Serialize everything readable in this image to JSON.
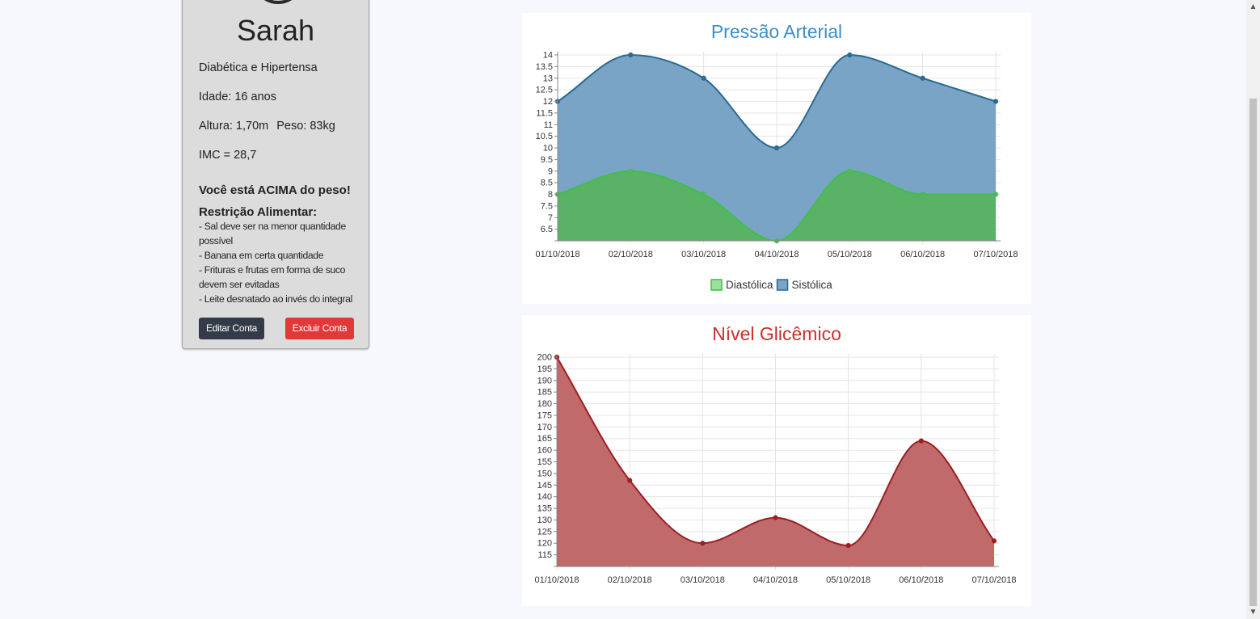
{
  "profile": {
    "name": "Sarah",
    "condition": "Diabética e Hipertensa",
    "age": "Idade: 16 anos",
    "height": "Altura: 1,70m",
    "weight": "Peso: 83kg",
    "bmi": "IMC = 28,7",
    "weight_status": "Você está ACIMA do peso!",
    "restriction_title": "Restrição Alimentar:",
    "restrictions": [
      "- Sal deve ser na menor quantidade possível",
      "- Banana em certa quantidade",
      "- Frituras e frutas em forma de suco devem ser evitadas",
      "- Leite desnatado ao invés do integral"
    ],
    "edit_label": "Editar Conta",
    "delete_label": "Excluir Conta"
  },
  "colors": {
    "card_bg": "#dcdcdc",
    "edit_button": "#333b48",
    "delete_button": "#e0393a",
    "pressure_title": "#3d8fc9",
    "glucose_title": "#c9302c"
  },
  "icons": {
    "avatar": "user-circle-icon",
    "scroll_up": "chevron-up-icon",
    "scroll_down": "chevron-down-icon"
  },
  "chart_data": [
    {
      "type": "area",
      "title": "Pressão Arterial",
      "title_color": "#3d8fc9",
      "x": [
        "01/10/2018",
        "02/10/2018",
        "03/10/2018",
        "04/10/2018",
        "05/10/2018",
        "06/10/2018",
        "07/10/2018"
      ],
      "ylim": [
        6,
        14
      ],
      "yticks": [
        "6.5",
        "7",
        "7.5",
        "8",
        "8.5",
        "9",
        "9.5",
        "10",
        "10.5",
        "11",
        "11.5",
        "12",
        "12.5",
        "13",
        "13.5",
        "14"
      ],
      "grid": true,
      "legend_position": "bottom",
      "series": [
        {
          "name": "Diastólica",
          "values": [
            8,
            9,
            8,
            6,
            9,
            8,
            8
          ],
          "fill": "#5ab266",
          "stroke": "#3fbf46",
          "legend_fill": "#9be09d",
          "legend_stroke": "#3fbf46"
        },
        {
          "name": "Sistólica",
          "values": [
            12,
            14,
            13,
            10,
            14,
            13,
            12
          ],
          "fill": "#79a4c6",
          "stroke": "#2a6a94",
          "legend_fill": "#79a4c6",
          "legend_stroke": "#2a6a94"
        }
      ]
    },
    {
      "type": "area",
      "title": "Nível Glicêmico",
      "title_color": "#c9302c",
      "x": [
        "01/10/2018",
        "02/10/2018",
        "03/10/2018",
        "04/10/2018",
        "05/10/2018",
        "06/10/2018",
        "07/10/2018"
      ],
      "ylim": [
        110,
        200
      ],
      "yticks": [
        "115",
        "120",
        "125",
        "130",
        "135",
        "140",
        "145",
        "150",
        "155",
        "160",
        "165",
        "170",
        "175",
        "180",
        "185",
        "190",
        "195",
        "200"
      ],
      "grid": true,
      "legend_position": "none",
      "series": [
        {
          "values": [
            200,
            147,
            120,
            131,
            119,
            164,
            121
          ],
          "fill": "#c06a6c",
          "stroke": "#9c1f22"
        }
      ]
    }
  ]
}
